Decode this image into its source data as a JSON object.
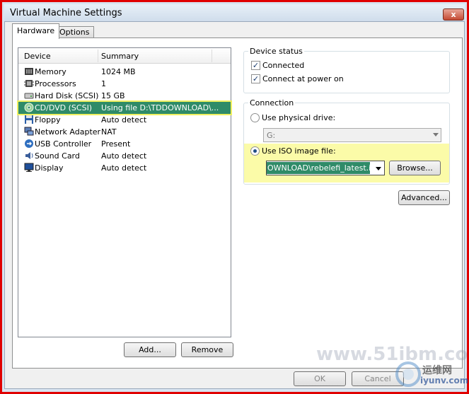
{
  "window": {
    "title": "Virtual Machine Settings",
    "close_label": "x"
  },
  "tabs": [
    {
      "label": "Hardware"
    },
    {
      "label": "Options"
    }
  ],
  "device_list": {
    "columns": {
      "device": "Device",
      "summary": "Summary"
    },
    "rows": [
      {
        "name": "Memory",
        "summary": "1024 MB",
        "icon": "memory-icon"
      },
      {
        "name": "Processors",
        "summary": "1",
        "icon": "processor-icon"
      },
      {
        "name": "Hard Disk (SCSI)",
        "summary": "15 GB",
        "icon": "hard-disk-icon"
      },
      {
        "name": "CD/DVD (SCSI)",
        "summary": "Using file D:\\TDDOWNLOAD\\...",
        "icon": "cd-dvd-icon",
        "selected": true
      },
      {
        "name": "Floppy",
        "summary": "Auto detect",
        "icon": "floppy-icon"
      },
      {
        "name": "Network Adapter",
        "summary": "NAT",
        "icon": "network-adapter-icon"
      },
      {
        "name": "USB Controller",
        "summary": "Present",
        "icon": "usb-icon"
      },
      {
        "name": "Sound Card",
        "summary": "Auto detect",
        "icon": "sound-card-icon"
      },
      {
        "name": "Display",
        "summary": "Auto detect",
        "icon": "display-icon"
      }
    ]
  },
  "buttons": {
    "add": "Add...",
    "remove": "Remove",
    "browse": "Browse...",
    "advanced": "Advanced...",
    "ok": "OK",
    "cancel": "Cancel"
  },
  "device_status": {
    "title": "Device status",
    "connected": {
      "label": "Connected",
      "checked": true
    },
    "connect_at_power_on": {
      "label": "Connect at power on",
      "checked": true
    }
  },
  "connection": {
    "title": "Connection",
    "physical": {
      "label": "Use physical drive:",
      "selected": false,
      "drive_value": "G:"
    },
    "iso": {
      "label": "Use ISO image file:",
      "selected": true,
      "file_value": "OWNLOAD\\rebelefi_latest.iso"
    }
  },
  "watermark": {
    "line1": "www.51ibm.com",
    "line2": "运维网",
    "line3": "iyunv.com"
  },
  "colors": {
    "selection": "#2f8b68",
    "highlight": "#fbfba8",
    "frame": "#e00000"
  }
}
